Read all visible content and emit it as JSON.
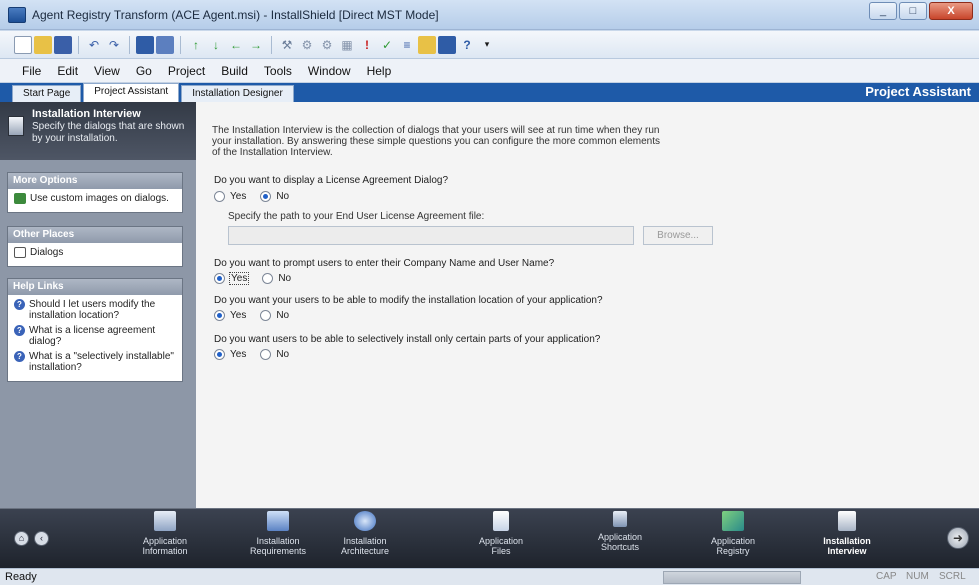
{
  "window": {
    "title": "Agent Registry Transform (ACE Agent.msi) - InstallShield [Direct MST Mode]",
    "minimize": "_",
    "maximize": "□",
    "close": "X"
  },
  "toolbar": {
    "icons": [
      "new-icon",
      "open-icon",
      "save-icon",
      "undo-icon",
      "redo-icon",
      "view1-icon",
      "view2-icon",
      "up-arrow-icon",
      "down-arrow-icon",
      "back-icon",
      "forward-icon",
      "build-icon",
      "compile-icon",
      "release-icon",
      "launch-icon",
      "run-icon",
      "help-icon"
    ]
  },
  "menu": {
    "items": [
      "File",
      "Edit",
      "View",
      "Go",
      "Project",
      "Build",
      "Tools",
      "Window",
      "Help"
    ]
  },
  "tabs": {
    "start": "Start Page",
    "project_assistant": "Project Assistant",
    "installation_designer": "Installation Designer",
    "panel_title": "Project Assistant"
  },
  "sidebar": {
    "header_title": "Installation Interview",
    "header_desc": "Specify the dialogs that are shown by your installation.",
    "more_options_title": "More Options",
    "more_options_items": [
      "Use custom images on dialogs."
    ],
    "other_places_title": "Other Places",
    "other_places_items": [
      "Dialogs"
    ],
    "help_links_title": "Help Links",
    "help_links_items": [
      "Should I let users modify the installation location?",
      "What is a license agreement dialog?",
      "What is a \"selectively installable\" installation?"
    ]
  },
  "main": {
    "intro": "The Installation Interview is the collection of dialogs that your users will see at run time when they run your installation. By answering these simple questions you can configure the more common elements of the Installation Interview.",
    "q1": "Do you want to display a License Agreement Dialog?",
    "q1_selected": "No",
    "path_label": "Specify the path to your End User License Agreement file:",
    "path_value": "",
    "browse": "Browse...",
    "q2": "Do you want to prompt users to enter their Company Name and User Name?",
    "q2_selected": "Yes",
    "q3": "Do you want your users to be able to modify the installation location of your application?",
    "q3_selected": "Yes",
    "q4": "Do you want users to be able to selectively install only certain parts of your application?",
    "q4_selected": "Yes",
    "yes": "Yes",
    "no": "No"
  },
  "bottomnav": {
    "items": [
      {
        "line1": "Application",
        "line2": "Information"
      },
      {
        "line1": "Installation",
        "line2": "Requirements"
      },
      {
        "line1": "Installation",
        "line2": "Architecture"
      },
      {
        "line1": "Application",
        "line2": "Files"
      },
      {
        "line1": "Application",
        "line2": "Shortcuts"
      },
      {
        "line1": "Application",
        "line2": "Registry"
      },
      {
        "line1": "Installation",
        "line2": "Interview"
      }
    ],
    "active_index": 6
  },
  "status": {
    "text": "Ready",
    "cap": "CAP",
    "num": "NUM",
    "scrl": "SCRL"
  }
}
